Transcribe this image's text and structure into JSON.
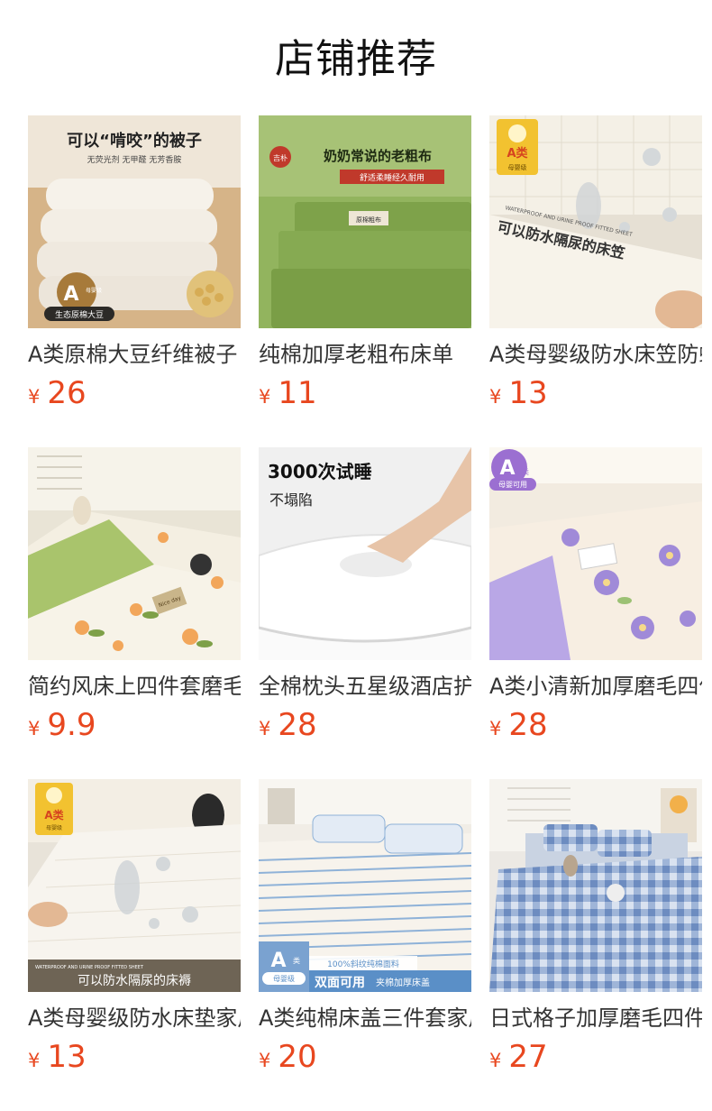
{
  "page": {
    "title": "店铺推荐"
  },
  "currency_symbol": "¥",
  "products": [
    {
      "name": "A类原棉大豆纤维被子",
      "price": "26",
      "image": {
        "type": "soybean-quilt",
        "headline": "可以“啃咬”的被子",
        "sub": "无荧光剂 无甲醛 无芳香胺",
        "badge": "A",
        "badge_sub": "母婴级",
        "tag": "生态原棉大豆",
        "colors": {
          "bg": "#d9b98c",
          "fabric": "#f4efe6"
        }
      }
    },
    {
      "name": "纯棉加厚老粗布床单",
      "price": "11",
      "image": {
        "type": "coarse-cloth",
        "headline": "奶奶常说的老粗布",
        "sub": "舒适柔睡经久耐用",
        "seal": "吉朴",
        "label": "原棉粗布",
        "colors": {
          "bg": "#8fb15a",
          "fabric": "#7ea34c"
        }
      }
    },
    {
      "name": "A类母婴级防水床笠防螨",
      "price": "13",
      "image": {
        "type": "waterproof-fitted",
        "badge": "A类",
        "badge_sub": "母婴级",
        "strip": "WATERPROOF AND URINE PROOF FITTED SHEET",
        "caption": "可以防水隔尿的床笠",
        "colors": {
          "bg": "#e8e2d6",
          "fabric": "#f7f3ea"
        }
      }
    },
    {
      "name": "简约风床上四件套磨毛",
      "price": "9.9",
      "image": {
        "type": "floral-set",
        "tag": "Nice day",
        "colors": {
          "bg": "#f1ede2",
          "accent": "#a9c46c",
          "flower": "#f2a65a"
        }
      }
    },
    {
      "name": "全棉枕头五星级酒店护颈",
      "price": "28",
      "image": {
        "type": "pillow",
        "headline": "3000次试睡",
        "sub": "不塌陷",
        "colors": {
          "bg": "#f2f2f2",
          "pillow": "#ffffff"
        }
      }
    },
    {
      "name": "A类小清新加厚磨毛四件套",
      "price": "28",
      "image": {
        "type": "purple-floral",
        "badge": "A",
        "badge_small": "类",
        "badge_sub": "母婴可用",
        "colors": {
          "bg": "#f3ece2",
          "sheet": "#b9a7e6",
          "flower": "#a08ad8"
        }
      }
    },
    {
      "name": "A类母婴级防水床垫家用",
      "price": "13",
      "image": {
        "type": "waterproof-pad",
        "badge": "A类",
        "badge_sub": "母婴级",
        "strip": "WATERPROOF AND URINE PROOF FITTED SHEET",
        "caption": "可以防水隔尿的床褥",
        "colors": {
          "bg": "#e9e4da",
          "fabric": "#f7f4ee"
        }
      }
    },
    {
      "name": "A类纯棉床盖三件套家用",
      "price": "20",
      "image": {
        "type": "bedspread",
        "badge": "A",
        "badge_small": "类",
        "badge_sub": "母婴级",
        "note": "100%斜纹纯棉面料",
        "caption_a": "双面可用",
        "caption_b": "夹棉加厚床盖",
        "colors": {
          "bg": "#f5f1ea",
          "stripe": "#8fb2d8",
          "accent": "#5a8fc7"
        }
      }
    },
    {
      "name": "日式格子加厚磨毛四件套",
      "price": "27",
      "image": {
        "type": "gingham",
        "colors": {
          "bg": "#ece9e4",
          "check": "#7f9cc8",
          "light": "#d9e2f0"
        }
      }
    }
  ]
}
